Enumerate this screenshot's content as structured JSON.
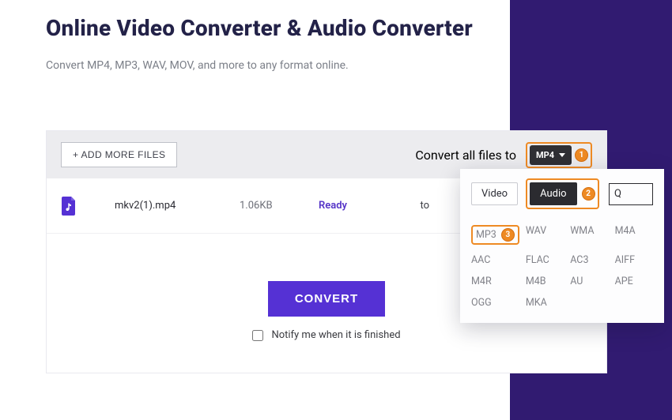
{
  "header": {
    "title": "Online Video Converter & Audio Converter",
    "subtitle": "Convert MP4, MP3, WAV, MOV, and more to any format online."
  },
  "toolbar": {
    "add_more_label": "+ ADD MORE FILES",
    "convert_all_label": "Convert all files to",
    "current_format": "MP4"
  },
  "callouts": {
    "one": "1",
    "two": "2",
    "three": "3"
  },
  "file_row": {
    "name": "mkv2(1).mp4",
    "size": "1.06KB",
    "status": "Ready",
    "to_label": "to"
  },
  "actions": {
    "convert_label": "CONVERT",
    "notify_label": "Notify me when it is finished"
  },
  "popup": {
    "tab_video": "Video",
    "tab_audio": "Audio",
    "search_placeholder": "Q",
    "formats": [
      "MP3",
      "WAV",
      "WMA",
      "M4A",
      "AAC",
      "FLAC",
      "AC3",
      "AIFF",
      "M4R",
      "M4B",
      "AU",
      "APE",
      "OGG",
      "MKA"
    ]
  }
}
